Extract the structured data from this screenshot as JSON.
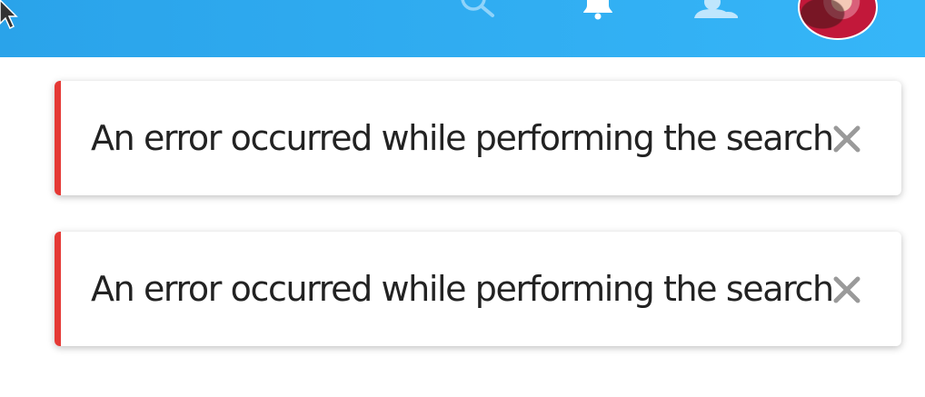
{
  "header": {
    "background_color": "#2aa3ea",
    "icons": [
      "cursor-icon",
      "search-icon",
      "bell-icon",
      "user-icon",
      "avatar"
    ]
  },
  "alerts": [
    {
      "message": "An error occurred while performing the search",
      "accent_color": "#e53935",
      "close_icon": "close-icon"
    },
    {
      "message": "An error occurred while performing the search",
      "accent_color": "#e53935",
      "close_icon": "close-icon"
    }
  ]
}
